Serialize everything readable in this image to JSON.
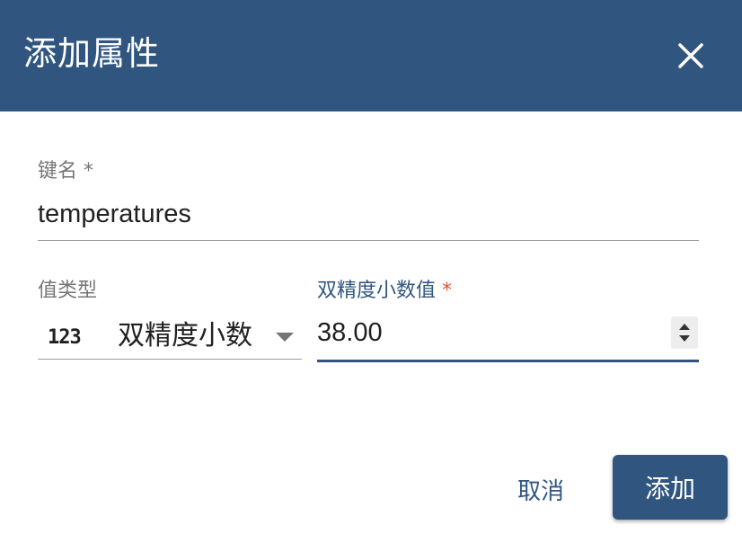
{
  "dialog": {
    "title": "添加属性",
    "close_icon": "close-icon",
    "header_color": "#305680"
  },
  "key_field": {
    "label": "键名",
    "required_mark": "*",
    "value": "temperatures"
  },
  "value_type_field": {
    "label": "值类型",
    "type_badge": "123",
    "selected": "双精度小数",
    "dropdown_icon": "chevron-down-icon"
  },
  "number_field": {
    "label": "双精度小数值",
    "required_mark": "*",
    "value": "38.00",
    "required_color": "#e0563b",
    "accent_color": "#305680"
  },
  "actions": {
    "cancel_label": "取消",
    "add_label": "添加"
  }
}
